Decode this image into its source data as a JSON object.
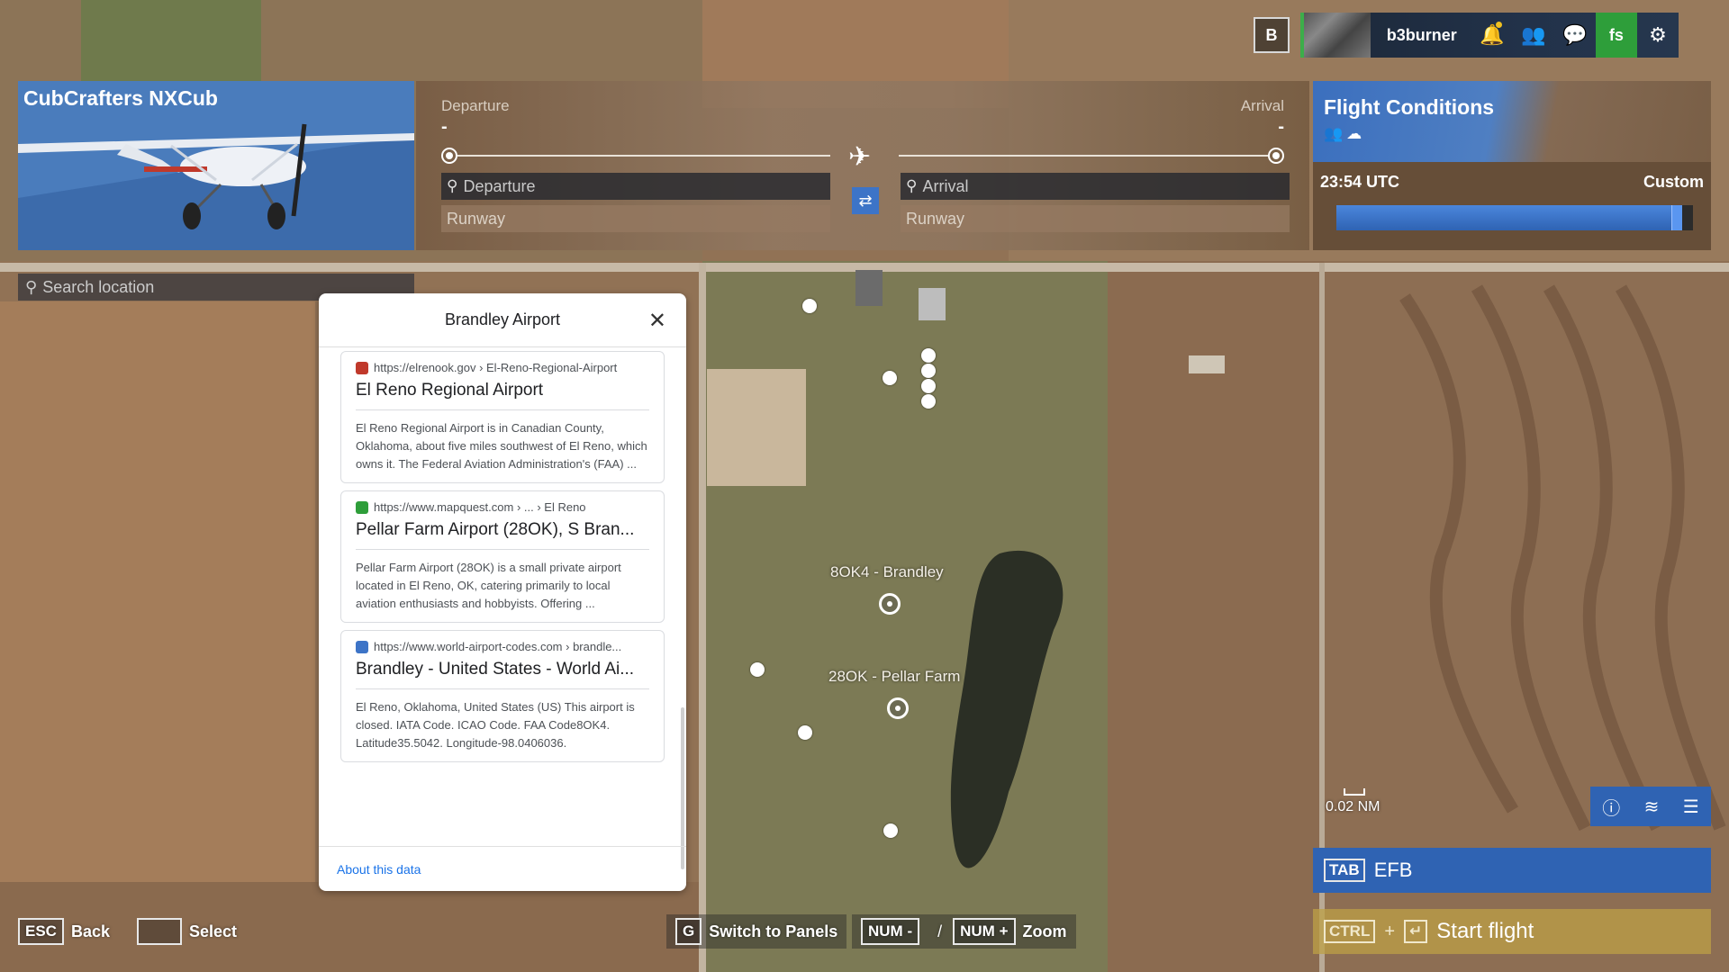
{
  "topbar": {
    "key_label": "B",
    "username": "b3burner",
    "fs_label": "fs"
  },
  "aircraft": {
    "name": "CubCrafters NXCub"
  },
  "flight_plan": {
    "departure_caption": "Departure",
    "arrival_caption": "Arrival",
    "departure_value": "-",
    "arrival_value": "-",
    "departure_placeholder": "Departure",
    "arrival_placeholder": "Arrival",
    "departure_runway": "Runway",
    "arrival_runway": "Runway"
  },
  "conditions": {
    "title": "Flight Conditions",
    "time": "23:54 UTC",
    "mode": "Custom",
    "time_of_day_fraction": 0.97
  },
  "search": {
    "placeholder": "Search location"
  },
  "popup": {
    "title": "Brandley Airport",
    "footer": "About this data",
    "results": [
      {
        "url": "https://elrenook.gov › El-Reno-Regional-Airport",
        "title": "El Reno Regional Airport",
        "text": "El Reno Regional Airport is in Canadian County, Oklahoma, about five miles southwest of El Reno, which owns it. The Federal Aviation Administration's (FAA) ...",
        "favicon_color": "#c0392b"
      },
      {
        "url": "https://www.mapquest.com › ... › El Reno",
        "title": "Pellar Farm Airport (28OK), S Bran...",
        "text": "Pellar Farm Airport (28OK) is a small private airport located in El Reno, OK, catering primarily to local aviation enthusiasts and hobbyists. Offering ...",
        "favicon_color": "#2e9e3a"
      },
      {
        "url": "https://www.world-airport-codes.com › brandle...",
        "title": "Brandley - United States - World Ai...",
        "text": "El Reno, Oklahoma, United States (US) This airport is closed. IATA Code. ICAO Code. FAA Code8OK4. Latitude35.5042. Longitude-98.0406036.",
        "favicon_color": "#3d74c7"
      }
    ]
  },
  "map": {
    "airports": [
      {
        "label": "8OK4 - Brandley"
      },
      {
        "label": "28OK - Pellar Farm"
      }
    ],
    "scale": "0.02 NM"
  },
  "efb": {
    "key": "TAB",
    "label": "EFB"
  },
  "start_flight": {
    "key": "CTRL",
    "label": "Start flight"
  },
  "bottom_controls": {
    "back_key": "ESC",
    "back_label": "Back",
    "select_label": "Select",
    "switch_key": "G",
    "switch_label": "Switch to Panels",
    "zoom_out_key": "NUM -",
    "zoom_in_key": "NUM +",
    "zoom_label": "Zoom"
  },
  "colors": {
    "accent_blue": "#2f63b3",
    "start_gold": "#bea046",
    "online_green": "#3cae4a"
  }
}
